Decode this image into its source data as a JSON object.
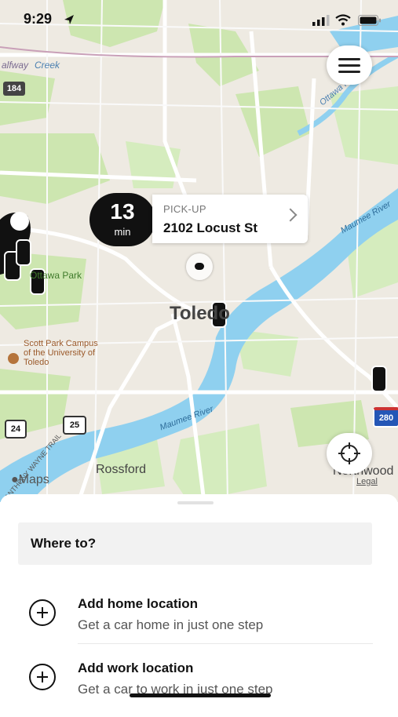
{
  "status_bar": {
    "time": "9:29"
  },
  "map": {
    "eta_value": "13",
    "eta_unit": "min",
    "pickup_label": "PICK-UP",
    "pickup_address": "2102 Locust St",
    "city_label": "Toledo",
    "labels": {
      "creek": "Creek",
      "railway": "alfway",
      "ottawa_river": "Ottawa River",
      "maumee_river_ne": "Maumee River",
      "maumee_river_sw": "Maumee River",
      "ottawa_park": "Ottawa Park",
      "scott_park": "Scott Park Campus of the University of Toledo",
      "rossford": "Rossford",
      "northwood": "Northwood",
      "trail": "ANTHONY WAYNE TRAIL",
      "maps_credit": "Maps",
      "legal": "Legal"
    },
    "shields": {
      "i184": "184",
      "us24": "24",
      "us25": "25",
      "i280": "280"
    }
  },
  "sheet": {
    "search_placeholder": "Where to?",
    "home_title": "Add home location",
    "home_subtitle": "Get a car home in just one step",
    "work_title": "Add work location",
    "work_subtitle": "Get a car to work in just one step"
  },
  "colors": {
    "water": "#8fd0ef",
    "park": "#cde6b0",
    "land": "#eeeae2",
    "road": "#ffffff",
    "dark": "#111111"
  }
}
